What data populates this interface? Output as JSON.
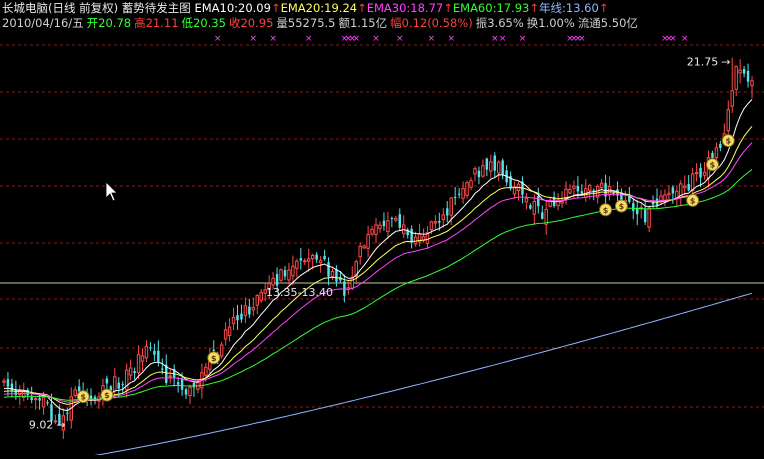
{
  "header": {
    "title": "长城电脑(日线 前复权) 蓄势待发主图",
    "indicators": [
      {
        "label": "EMA10:20.09",
        "color": "#ffffff"
      },
      {
        "label": "EMA20:19.24",
        "color": "#ffff66"
      },
      {
        "label": "EMA30:18.77",
        "color": "#ff44ff"
      },
      {
        "label": "EMA60:17.93",
        "color": "#33ff33"
      },
      {
        "label": "年线:13.60",
        "color": "#8fb8ff"
      }
    ],
    "up_arrow": "↑",
    "stats": [
      {
        "label": "2010/04/16/五",
        "color": "#d0d0d0"
      },
      {
        "label": "开20.78",
        "color": "#33ff33"
      },
      {
        "label": "高21.11",
        "color": "#ff4040"
      },
      {
        "label": "低20.35",
        "color": "#33ff33"
      },
      {
        "label": "收20.95",
        "color": "#ff4040"
      },
      {
        "label": "量55275.5",
        "color": "#d0d0d0"
      },
      {
        "label": "额1.15亿",
        "color": "#d0d0d0"
      },
      {
        "label": "幅0.12(0.58%)",
        "color": "#ff4040"
      },
      {
        "label": "振3.65%",
        "color": "#d0d0d0"
      },
      {
        "label": "换1.00%",
        "color": "#d0d0d0"
      },
      {
        "label": "流通5.50亿",
        "color": "#d0d0d0"
      }
    ]
  },
  "colors": {
    "background": "#000000",
    "grid": "#8b1a1a",
    "up": "#ff4b4b",
    "down": "#54e3ea",
    "ema10": "#ffffff",
    "ema20": "#ffff66",
    "ema30": "#ff44ff",
    "ema60": "#33ff33",
    "annual": "#8fb8ff",
    "marker": "#ff44ff",
    "level_line": "#c9c9a0"
  },
  "chart_data": {
    "type": "candlestick",
    "title": "长城电脑(日线 前复权) 蓄势待发主图",
    "ylim": [
      8.0,
      22.5
    ],
    "grid": true,
    "legend": "top",
    "n_bars": 190,
    "overlays": [
      "EMA10",
      "EMA20",
      "EMA30",
      "EMA60",
      "年线"
    ],
    "latest": {
      "date": "2010/04/16",
      "open": 20.78,
      "high": 21.11,
      "low": 20.35,
      "close": 20.95,
      "EMA10": 20.09,
      "EMA20": 19.24,
      "EMA30": 18.77,
      "EMA60": 17.93,
      "年线": 13.6
    },
    "anchors": [
      {
        "bar": 0,
        "close": 10.4
      },
      {
        "bar": 10,
        "close": 9.9
      },
      {
        "bar": 13,
        "close": 9.1
      },
      {
        "bar": 18,
        "close": 10.0
      },
      {
        "bar": 24,
        "close": 10.1
      },
      {
        "bar": 30,
        "close": 10.6
      },
      {
        "bar": 36,
        "close": 11.6
      },
      {
        "bar": 42,
        "close": 10.6
      },
      {
        "bar": 46,
        "close": 10.1
      },
      {
        "bar": 52,
        "close": 11.2
      },
      {
        "bar": 58,
        "close": 12.5
      },
      {
        "bar": 66,
        "close": 13.6
      },
      {
        "bar": 72,
        "close": 14.6
      },
      {
        "bar": 80,
        "close": 14.7
      },
      {
        "bar": 86,
        "close": 13.6
      },
      {
        "bar": 92,
        "close": 15.7
      },
      {
        "bar": 98,
        "close": 16.2
      },
      {
        "bar": 104,
        "close": 15.3
      },
      {
        "bar": 112,
        "close": 16.5
      },
      {
        "bar": 118,
        "close": 17.6
      },
      {
        "bar": 124,
        "close": 18.0
      },
      {
        "bar": 130,
        "close": 17.2
      },
      {
        "bar": 136,
        "close": 16.3
      },
      {
        "bar": 142,
        "close": 17.2
      },
      {
        "bar": 150,
        "close": 17.3
      },
      {
        "bar": 156,
        "close": 17.0
      },
      {
        "bar": 162,
        "close": 16.3
      },
      {
        "bar": 168,
        "close": 17.0
      },
      {
        "bar": 174,
        "close": 17.5
      },
      {
        "bar": 178,
        "close": 18.2
      },
      {
        "bar": 182,
        "close": 19.0
      },
      {
        "bar": 185,
        "close": 21.5
      },
      {
        "bar": 189,
        "close": 20.95
      }
    ],
    "annotations": [
      {
        "text": "21.75",
        "bar": 184,
        "price": 21.75,
        "kind": "high"
      },
      {
        "text": "9.02",
        "bar": 14,
        "price": 9.02,
        "kind": "low"
      },
      {
        "text": "13.35-13.40",
        "price": 13.4,
        "kind": "level"
      }
    ],
    "signal_bars": [
      20,
      26,
      53,
      152,
      156,
      174,
      179,
      183
    ],
    "top_markers": [
      54,
      63,
      68,
      77,
      86,
      87,
      88,
      89,
      94,
      100,
      108,
      113,
      124,
      126,
      131,
      143,
      144,
      145,
      146,
      167,
      168,
      169,
      172
    ]
  }
}
